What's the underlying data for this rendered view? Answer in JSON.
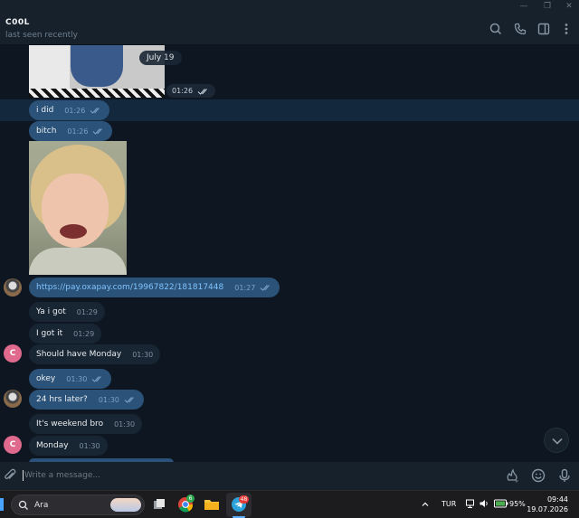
{
  "window": {
    "title_controls": [
      "—",
      "❐",
      "✕"
    ]
  },
  "header": {
    "contact_name": "C00L",
    "status": "last seen recently"
  },
  "chat": {
    "date_badge": "July 19",
    "photo1_time": "01:26",
    "messages": [
      {
        "text": "i did",
        "time": "01:26",
        "dir": "out"
      },
      {
        "text": "bitch",
        "time": "01:26",
        "dir": "out"
      },
      {
        "text": "https://pay.oxapay.com/19967822/181817448",
        "time": "01:27",
        "dir": "out"
      },
      {
        "text": "Ya i got",
        "time": "01:29",
        "dir": "in"
      },
      {
        "text": "I got it",
        "time": "01:29",
        "dir": "in"
      },
      {
        "text": "Should have Monday",
        "time": "01:30",
        "dir": "in"
      },
      {
        "text": "okey",
        "time": "01:30",
        "dir": "out"
      },
      {
        "text": "24 hrs later?",
        "time": "01:30",
        "dir": "out"
      },
      {
        "text": "It's weekend bro",
        "time": "01:30",
        "dir": "in"
      },
      {
        "text": "Monday",
        "time": "01:30",
        "dir": "in"
      }
    ],
    "avatar_letter": "C"
  },
  "composer": {
    "placeholder": "Write a message..."
  },
  "taskbar": {
    "search_label": "Ara",
    "chrome_badge": "6",
    "telegram_badge": "48",
    "language": "TUR",
    "battery": "95%",
    "time": "09:44",
    "date": "19.07.2026"
  },
  "colors": {
    "bg": "#0e1621",
    "bubble_out": "#2b5278",
    "bubble_in": "#182533",
    "avatar_c": "#e06a8d",
    "link": "#7fc3ff"
  }
}
